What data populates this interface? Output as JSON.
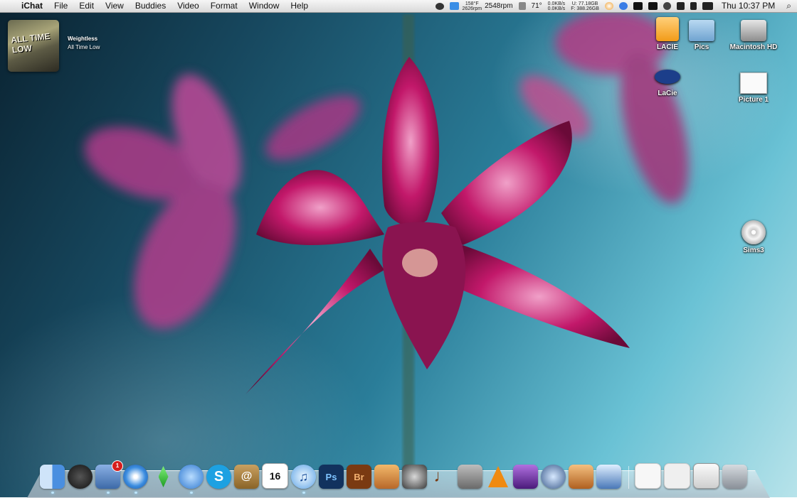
{
  "menubar": {
    "apple_glyph": "",
    "app_name": "iChat",
    "menus": [
      "File",
      "Edit",
      "View",
      "Buddies",
      "Video",
      "Format",
      "Window",
      "Help"
    ],
    "temp_top": "158°F",
    "temp_bottom": "2626rpm",
    "fan": "2548rpm",
    "weather": "71°",
    "net_up": "0.0KB/s",
    "net_down": "0.0KB/s",
    "disk_used": "U: 77.18GB",
    "disk_free": "F: 388.26GB",
    "clock": "Thu 10:37 PM"
  },
  "now_playing": {
    "album_text": "ALL TIME LOW",
    "title": "Weightless",
    "artist": "All Time Low"
  },
  "desktop_icons": [
    {
      "label": "LACIE",
      "icon": "drive-orange-icon"
    },
    {
      "label": "Pics",
      "icon": "folder-icon"
    },
    {
      "label": "Macintosh HD",
      "icon": "hard-drive-icon"
    },
    {
      "label": "LaCie",
      "icon": "lacie-logo-icon"
    },
    {
      "label": "Picture 1",
      "icon": "screenshot-file-icon"
    },
    {
      "label": "Sims3",
      "icon": "dvd-icon"
    }
  ],
  "dock": {
    "calendar_day": "16",
    "mail_badge": "1",
    "ps_label": "Ps",
    "br_label": "Br",
    "colors": {
      "finder": "#4a8fe0",
      "photoshop": "#12325e",
      "bridge": "#7a3a12",
      "skype": "#1da1e2",
      "vlc": "#f08a10"
    }
  }
}
